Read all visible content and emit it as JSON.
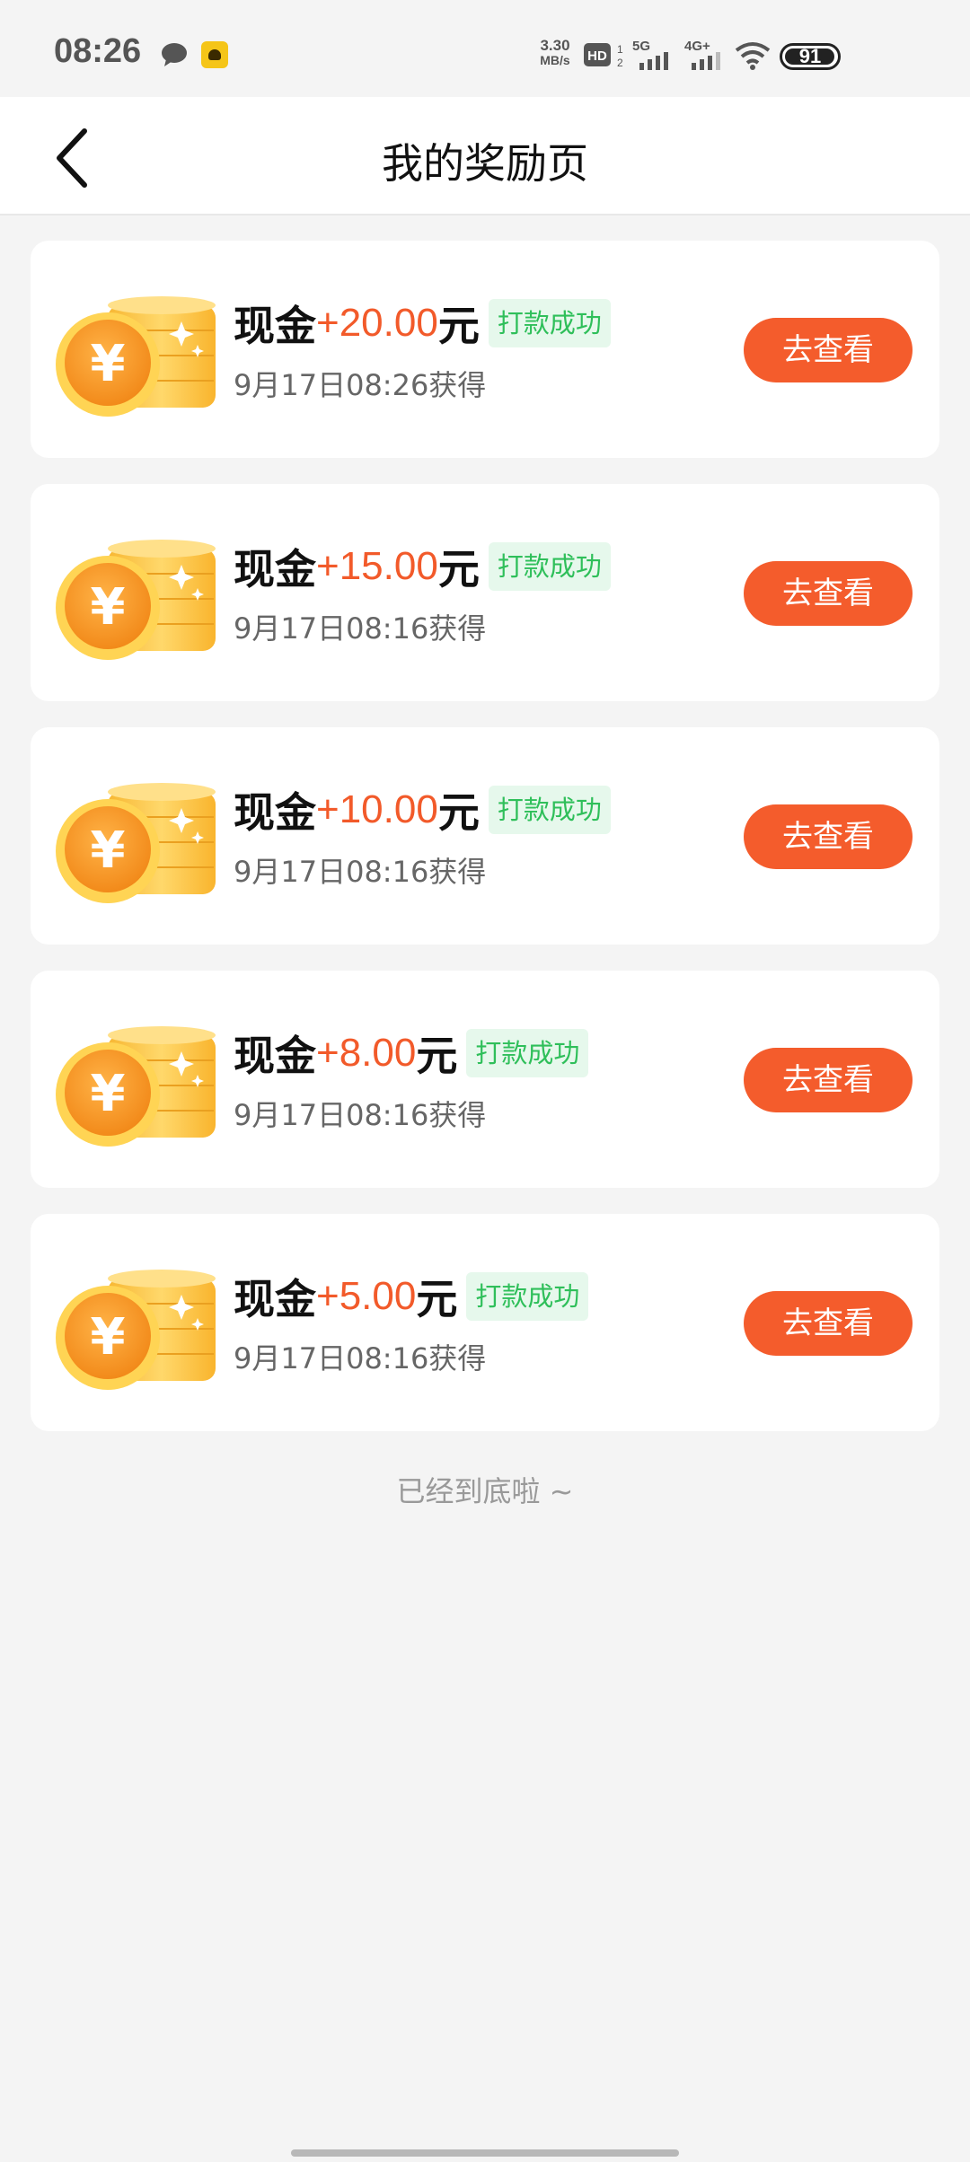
{
  "status_bar": {
    "time": "08:26",
    "speed_value": "3.30",
    "speed_unit": "MB/s",
    "battery": "91",
    "icons": [
      "chat-icon",
      "app-notification-icon",
      "hd-icon",
      "5g-signal-icon",
      "4g-signal-icon",
      "wifi-icon",
      "battery-icon"
    ]
  },
  "header": {
    "title": "我的奖励页",
    "back_icon": "chevron-left-icon"
  },
  "rewards": [
    {
      "label": "现金",
      "amount": "+20.00",
      "unit": "元",
      "status": "打款成功",
      "time": "9月17日08:26获得",
      "button": "去查看"
    },
    {
      "label": "现金",
      "amount": "+15.00",
      "unit": "元",
      "status": "打款成功",
      "time": "9月17日08:16获得",
      "button": "去查看"
    },
    {
      "label": "现金",
      "amount": "+10.00",
      "unit": "元",
      "status": "打款成功",
      "time": "9月17日08:16获得",
      "button": "去查看"
    },
    {
      "label": "现金",
      "amount": "+8.00",
      "unit": "元",
      "status": "打款成功",
      "time": "9月17日08:16获得",
      "button": "去查看"
    },
    {
      "label": "现金",
      "amount": "+5.00",
      "unit": "元",
      "status": "打款成功",
      "time": "9月17日08:16获得",
      "button": "去查看"
    }
  ],
  "end_text": "已经到底啦 ~",
  "colors": {
    "accent": "#f45c2c",
    "amount": "#f25a2a",
    "success_text": "#2fbf5a",
    "success_bg": "#e6f8ec",
    "background": "#f4f4f4"
  }
}
